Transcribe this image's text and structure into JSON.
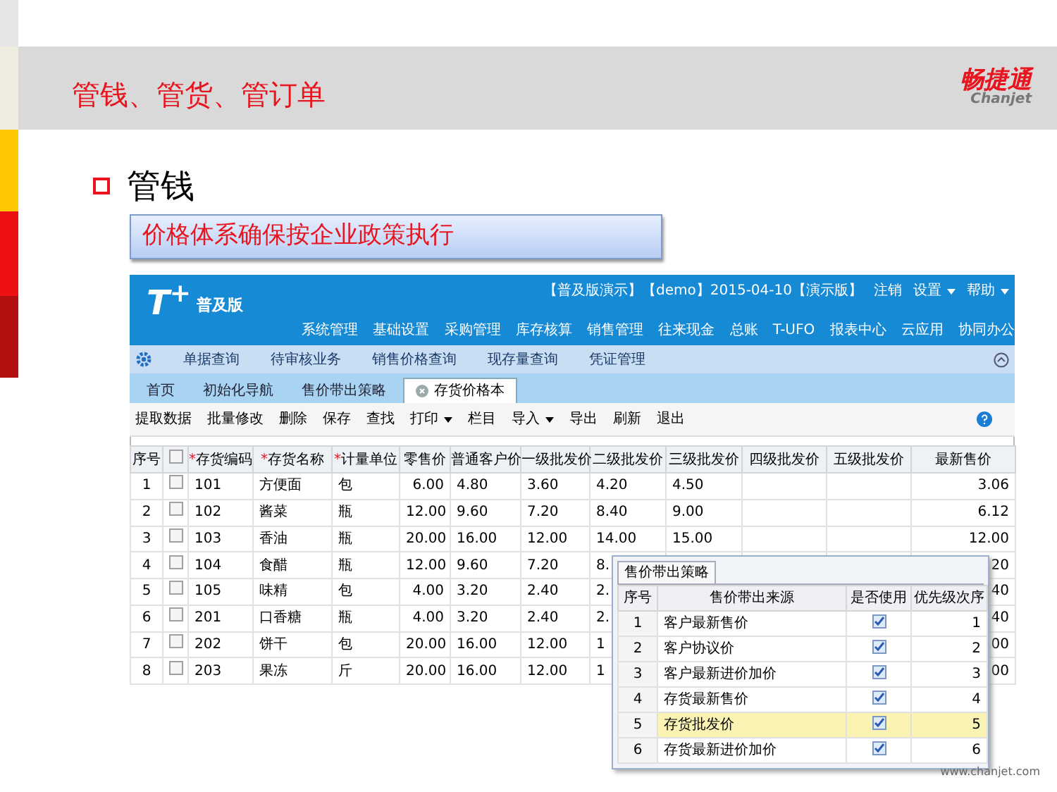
{
  "slide": {
    "title": "管钱、管货、管订单",
    "logo": {
      "name": "畅捷通",
      "latin": "Chanjet"
    },
    "heading": "管钱",
    "callout": "价格体系确保按企业政策执行",
    "footer": "www.chanjet.com"
  },
  "app": {
    "logo": {
      "mark": "T$^{+}$",
      "edition": "普及版"
    },
    "status": [
      {
        "text": "【普及版演示】【demo】2015-04-10【演示版】",
        "caret": false
      },
      {
        "text": "注销",
        "caret": false
      },
      {
        "text": "设置",
        "caret": true
      },
      {
        "text": "帮助",
        "caret": true
      }
    ],
    "menu": [
      "系统管理",
      "基础设置",
      "采购管理",
      "库存核算",
      "销售管理",
      "往来现金",
      "总账",
      "T-UFO",
      "报表中心",
      "云应用",
      "协同办公"
    ],
    "subnav": [
      "单据查询",
      "待审核业务",
      "销售价格查询",
      "现存量查询",
      "凭证管理"
    ],
    "tabs": [
      {
        "label": "首页",
        "selected": false,
        "closable": false
      },
      {
        "label": "初始化导航",
        "selected": false,
        "closable": false
      },
      {
        "label": "售价带出策略",
        "selected": false,
        "closable": false
      },
      {
        "label": "存货价格本",
        "selected": true,
        "closable": true
      }
    ],
    "toolbar": [
      {
        "label": "提取数据",
        "caret": false
      },
      {
        "label": "批量修改",
        "caret": false
      },
      {
        "label": "删除",
        "caret": false
      },
      {
        "label": "保存",
        "caret": false
      },
      {
        "label": "查找",
        "caret": false
      },
      {
        "label": "打印",
        "caret": true
      },
      {
        "label": "栏目",
        "caret": false
      },
      {
        "label": "导入",
        "caret": true
      },
      {
        "label": "导出",
        "caret": false
      },
      {
        "label": "刷新",
        "caret": false
      },
      {
        "label": "退出",
        "caret": false
      }
    ],
    "table": {
      "columns": [
        {
          "label": "序号"
        },
        {
          "mark": "*",
          "label": "存货编码"
        },
        {
          "mark": "*",
          "label": "存货名称"
        },
        {
          "mark": "*",
          "label": "计量单位"
        },
        {
          "label": "零售价"
        },
        {
          "label": "普通客户价"
        },
        {
          "label": "一级批发价"
        },
        {
          "label": "二级批发价"
        },
        {
          "label": "三级批发价"
        },
        {
          "label": "四级批发价"
        },
        {
          "label": "五级批发价"
        },
        {
          "label": "最新售价"
        }
      ],
      "all_checked": false,
      "rows": [
        {
          "no": "1",
          "checked": false,
          "code": "101",
          "name": "方便面",
          "unit": "包",
          "retail": "6.00",
          "normal": "4.80",
          "l1": "3.60",
          "l2": "4.20",
          "l3": "4.50",
          "latest": "3.06"
        },
        {
          "no": "2",
          "checked": false,
          "code": "102",
          "name": "酱菜",
          "unit": "瓶",
          "retail": "12.00",
          "normal": "9.60",
          "l1": "7.20",
          "l2": "8.40",
          "l3": "9.00",
          "latest": "6.12"
        },
        {
          "no": "3",
          "checked": false,
          "code": "103",
          "name": "香油",
          "unit": "瓶",
          "retail": "20.00",
          "normal": "16.00",
          "l1": "12.00",
          "l2": "14.00",
          "l3": "15.00",
          "latest": "12.00"
        },
        {
          "no": "4",
          "checked": false,
          "code": "104",
          "name": "食醋",
          "unit": "瓶",
          "retail": "12.00",
          "normal": "9.60",
          "l1": "7.20",
          "l2": "8.",
          "latest": ".20"
        },
        {
          "no": "5",
          "checked": false,
          "code": "105",
          "name": "味精",
          "unit": "包",
          "retail": "4.00",
          "normal": "3.20",
          "l1": "2.40",
          "l2": "2.",
          "latest": ".40"
        },
        {
          "no": "6",
          "checked": false,
          "code": "201",
          "name": "口香糖",
          "unit": "瓶",
          "retail": "4.00",
          "normal": "3.20",
          "l1": "2.40",
          "l2": "2.",
          "latest": ".40"
        },
        {
          "no": "7",
          "checked": false,
          "code": "202",
          "name": "饼干",
          "unit": "包",
          "retail": "20.00",
          "normal": "16.00",
          "l1": "12.00",
          "l2": "1",
          "latest": ".00"
        },
        {
          "no": "8",
          "checked": false,
          "code": "203",
          "name": "果冻",
          "unit": "斤",
          "retail": "20.00",
          "normal": "16.00",
          "l1": "12.00",
          "l2": "1",
          "latest": ".00"
        }
      ]
    },
    "popup": {
      "tab": "售价带出策略",
      "columns": [
        "序号",
        "售价带出来源",
        "是否使用",
        "优先级次序"
      ],
      "rows": [
        {
          "no": "1",
          "source": "客户最新售价",
          "used": true,
          "priority": "1",
          "selected": false
        },
        {
          "no": "2",
          "source": "客户协议价",
          "used": true,
          "priority": "2",
          "selected": false
        },
        {
          "no": "3",
          "source": "客户最新进价加价",
          "used": true,
          "priority": "3",
          "selected": false
        },
        {
          "no": "4",
          "source": "存货最新售价",
          "used": true,
          "priority": "4",
          "selected": false
        },
        {
          "no": "5",
          "source": "存货批发价",
          "used": true,
          "priority": "5",
          "selected": true
        },
        {
          "no": "6",
          "source": "存货最新进价加价",
          "used": true,
          "priority": "6",
          "selected": false
        }
      ]
    }
  }
}
